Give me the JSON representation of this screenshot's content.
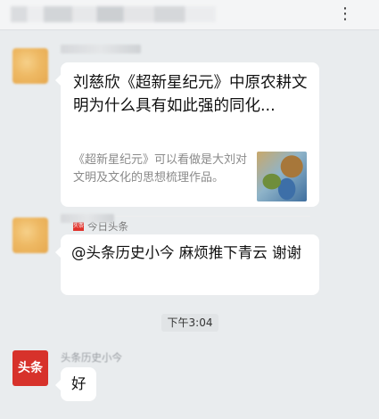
{
  "header": {
    "more_icon": "⋮"
  },
  "messages": [
    {
      "type": "link-card",
      "title": "刘慈欣《超新星纪元》中原农耕文明为什么具有如此强的同化...",
      "description": "《超新星纪元》可以看做是大刘对文明及文化的思想梳理作品。",
      "source": {
        "logo_text": "头条",
        "name": "今日头条"
      }
    },
    {
      "type": "text",
      "text": "@头条历史小今  麻烦推下青云 谢谢"
    }
  ],
  "timestamp": "下午3:04",
  "reply": {
    "avatar_text": "头条",
    "sender_name": "头条历史小今",
    "text": "好"
  },
  "colors": {
    "background": "#e9ecee",
    "bubble": "#ffffff",
    "toutiao_red": "#d7322b"
  }
}
